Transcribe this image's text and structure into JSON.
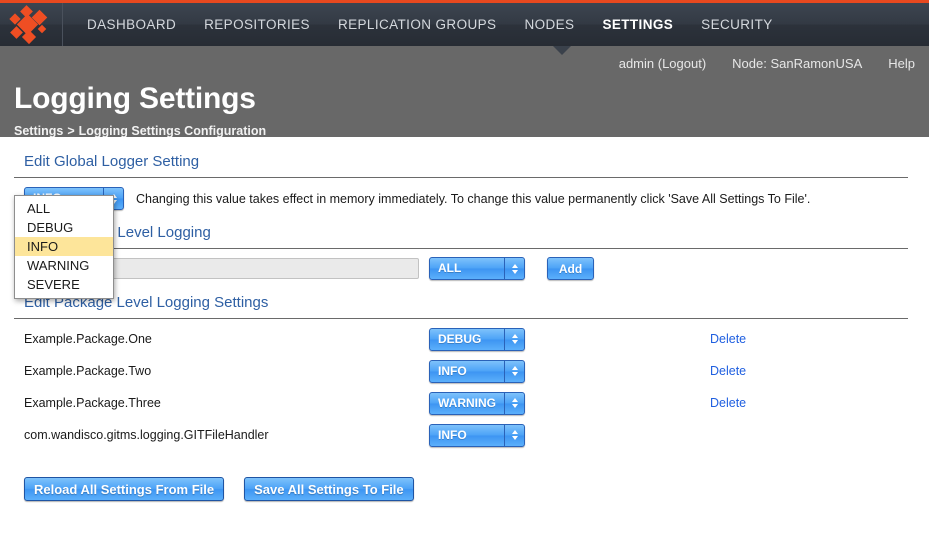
{
  "topnav": {
    "logo_name": "wandisco-diamond-logo",
    "items": [
      {
        "label": "DASHBOARD",
        "active": false
      },
      {
        "label": "REPOSITORIES",
        "active": false
      },
      {
        "label": "REPLICATION GROUPS",
        "active": false
      },
      {
        "label": "NODES",
        "active": false
      },
      {
        "label": "SETTINGS",
        "active": true
      },
      {
        "label": "SECURITY",
        "active": false
      }
    ]
  },
  "header": {
    "user": "admin (Logout)",
    "node": "Node: SanRamonUSA",
    "help": "Help",
    "title": "Logging Settings",
    "breadcrumb_root": "Settings",
    "breadcrumb_sep": ">",
    "breadcrumb_current": "Logging Settings Configuration"
  },
  "global_section": {
    "heading": "Edit Global Logger Setting",
    "selected_level": "INFO",
    "note": "Changing this value takes effect in memory immediately. To change this value permanently click 'Save All Settings To File'.",
    "options": [
      "ALL",
      "DEBUG",
      "INFO",
      "WARNING",
      "SEVERE"
    ],
    "highlighted_option": "INFO",
    "menu_open": true
  },
  "add_section": {
    "heading": "Add Package Level Logging",
    "package_value": "",
    "package_placeholder": "",
    "level": "ALL",
    "add_label": "Add"
  },
  "edit_section": {
    "heading": "Edit Package Level Logging Settings",
    "delete_label": "Delete",
    "rows": [
      {
        "package": "Example.Package.One",
        "level": "DEBUG",
        "deletable": true
      },
      {
        "package": "Example.Package.Two",
        "level": "INFO",
        "deletable": true
      },
      {
        "package": "Example.Package.Three",
        "level": "WARNING",
        "deletable": true
      },
      {
        "package": "com.wandisco.gitms.logging.GITFileHandler",
        "level": "INFO",
        "deletable": false
      }
    ]
  },
  "footer": {
    "reload_label": "Reload All Settings From File",
    "save_label": "Save All Settings To File"
  },
  "colors": {
    "brand_orange": "#ef4e23",
    "nav_dark": "#2f353f",
    "header_gray": "#686868",
    "heading_blue": "#2e5fa3",
    "link_blue": "#1f5fe0",
    "control_blue": "#4da3f7",
    "highlight_yellow": "#fde59a"
  }
}
